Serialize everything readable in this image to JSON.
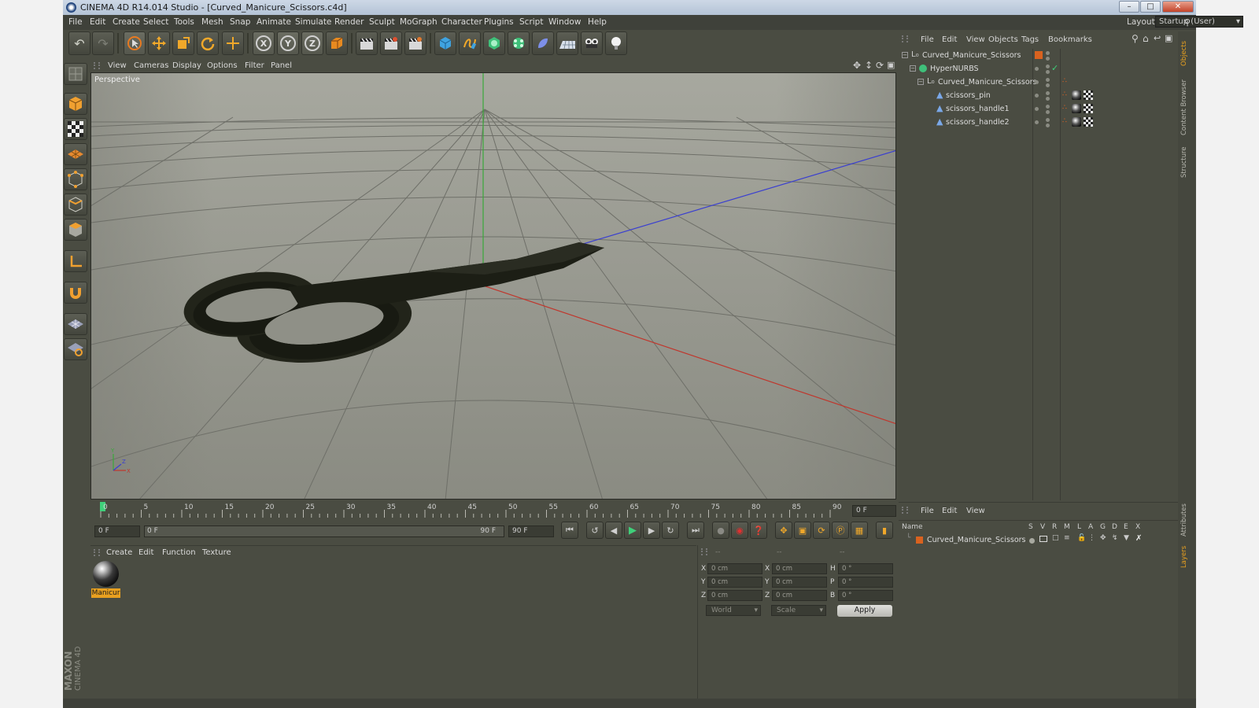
{
  "window": {
    "title": "CINEMA 4D R14.014 Studio - [Curved_Manicure_Scissors.c4d]",
    "minimize": "–",
    "maximize": "□",
    "close": "✕"
  },
  "menubar": {
    "items": [
      "File",
      "Edit",
      "Create",
      "Select",
      "Tools",
      "Mesh",
      "Snap",
      "Animate",
      "Simulate",
      "Render",
      "Sculpt",
      "MoGraph",
      "Character",
      "Plugins",
      "Script",
      "Window",
      "Help"
    ],
    "layout_label": "Layout:",
    "layout_value": "Startup (User)"
  },
  "toolbar": {
    "axis_x": "X",
    "axis_y": "Y",
    "axis_z": "Z"
  },
  "viewport": {
    "menu": [
      "View",
      "Cameras",
      "Display",
      "Options",
      "Filter",
      "Panel"
    ],
    "label": "Perspective",
    "axis_y_label": "Y",
    "axis_x_label": "X",
    "axis_z_label": "Z"
  },
  "timeline": {
    "ticks": [
      "0",
      "5",
      "10",
      "15",
      "20",
      "25",
      "30",
      "35",
      "40",
      "45",
      "50",
      "55",
      "60",
      "65",
      "70",
      "75",
      "80",
      "85",
      "90"
    ],
    "current_frame": "0 F",
    "start_field": "0 F",
    "range_start": "0 F",
    "range_end": "90 F",
    "end_field": "90 F",
    "current_position": 0
  },
  "material_manager": {
    "menu": [
      "Create",
      "Edit",
      "Function",
      "Texture"
    ],
    "materials": [
      {
        "label": "Manicur"
      }
    ]
  },
  "coordinates": {
    "headers": [
      "--",
      "--",
      "--"
    ],
    "rows": [
      {
        "pos_label": "X",
        "pos": "0 cm",
        "size_label": "X",
        "size": "0 cm",
        "rot_label": "H",
        "rot": "0 °"
      },
      {
        "pos_label": "Y",
        "pos": "0 cm",
        "size_label": "Y",
        "size": "0 cm",
        "rot_label": "P",
        "rot": "0 °"
      },
      {
        "pos_label": "Z",
        "pos": "0 cm",
        "size_label": "Z",
        "size": "0 cm",
        "rot_label": "B",
        "rot": "0 °"
      }
    ],
    "mode_world": "World",
    "mode_scale": "Scale",
    "apply": "Apply"
  },
  "object_manager": {
    "menu": [
      "File",
      "Edit",
      "View",
      "Objects",
      "Tags",
      "Bookmarks"
    ],
    "objects": [
      {
        "name": "Curved_Manicure_Scissors"
      },
      {
        "name": "HyperNURBS"
      },
      {
        "name": "Curved_Manicure_Scissors"
      },
      {
        "name": "scissors_pin"
      },
      {
        "name": "scissors_handle1"
      },
      {
        "name": "scissors_handle2"
      }
    ]
  },
  "layer_manager": {
    "menu": [
      "File",
      "Edit",
      "View"
    ],
    "columns": [
      "Name",
      "S",
      "V",
      "R",
      "M",
      "L",
      "A",
      "G",
      "D",
      "E",
      "X"
    ],
    "layers": [
      {
        "name": "Curved_Manicure_Scissors"
      }
    ]
  },
  "right_tabs": [
    "Objects",
    "Content Browser",
    "Structure",
    "Attributes",
    "Layers"
  ],
  "brand": {
    "line1": "MAXON",
    "line2": "CINEMA 4D"
  },
  "colors": {
    "accent_orange": "#e8a020",
    "layer_orange": "#d9621f",
    "axis_red": "#c0362c",
    "axis_blue": "#3a3fd0",
    "axis_green": "#3aa83a"
  }
}
